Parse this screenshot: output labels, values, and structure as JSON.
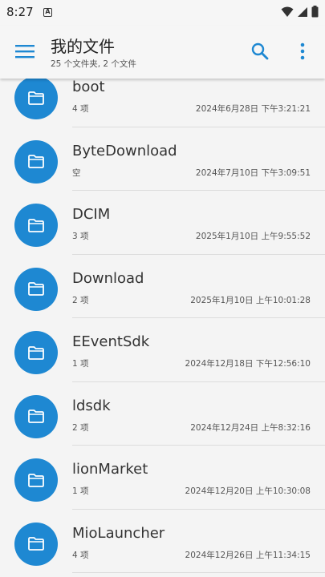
{
  "status": {
    "time": "8:27",
    "notification_glyph": "A"
  },
  "header": {
    "title": "我的文件",
    "subtitle": "25 个文件夹, 2 个文件"
  },
  "colors": {
    "accent": "#1e88d2",
    "folder": "#1e88d2"
  },
  "icons": {
    "menu": "hamburger-icon",
    "search": "search-icon",
    "more": "more-vert-icon",
    "folder": "folder-icon"
  },
  "items": [
    {
      "name": "boot",
      "count": "4 项",
      "date": "2024年6月28日 下午3:21:21"
    },
    {
      "name": "ByteDownload",
      "count": "空",
      "date": "2024年7月10日 下午3:09:51"
    },
    {
      "name": "DCIM",
      "count": "3 项",
      "date": "2025年1月10日 上午9:55:52"
    },
    {
      "name": "Download",
      "count": "2 项",
      "date": "2025年1月10日 上午10:01:28"
    },
    {
      "name": "EEventSdk",
      "count": "1 项",
      "date": "2024年12月18日 下午12:56:10"
    },
    {
      "name": "ldsdk",
      "count": "2 项",
      "date": "2024年12月24日 上午8:32:16"
    },
    {
      "name": "lionMarket",
      "count": "1 项",
      "date": "2024年12月20日 上午10:30:08"
    },
    {
      "name": "MioLauncher",
      "count": "4 项",
      "date": "2024年12月26日 上午11:34:15"
    }
  ]
}
